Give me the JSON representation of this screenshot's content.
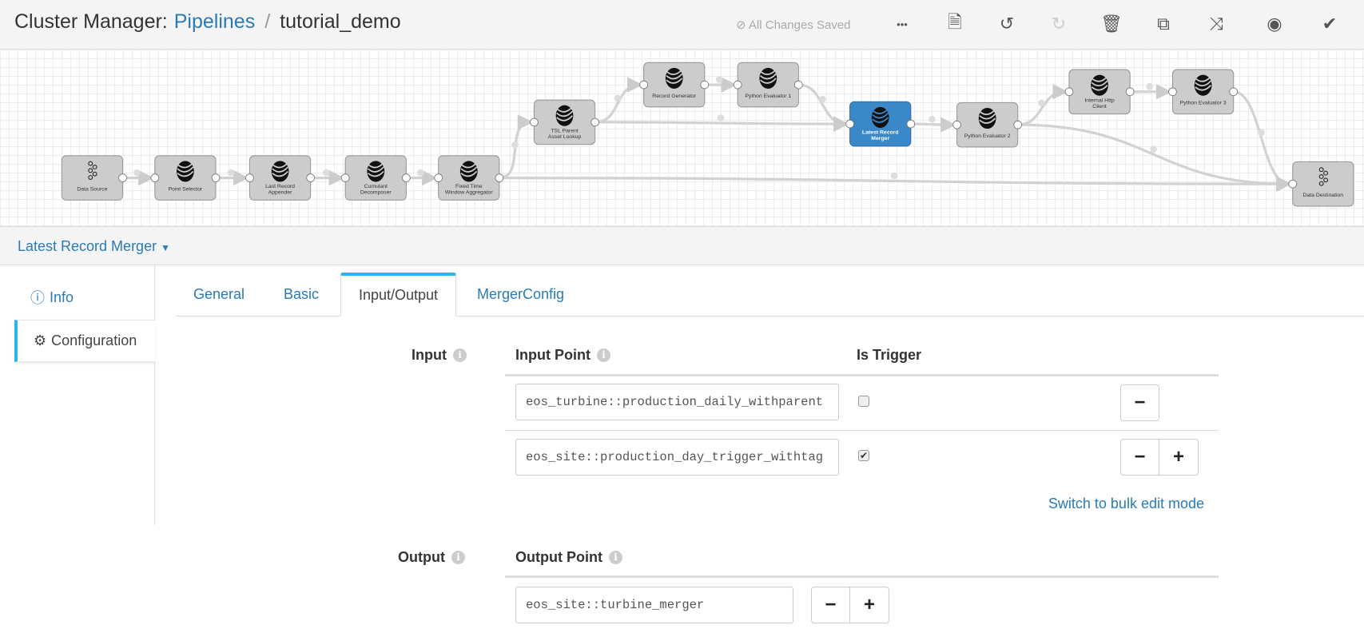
{
  "header": {
    "app": "Cluster Manager:",
    "breadcrumb_link": "Pipelines",
    "separator": "/",
    "pipeline": "tutorial_demo",
    "status": "All Changes Saved"
  },
  "toolbar": [
    {
      "icon": "ellipsis-icon",
      "glyph": "•••"
    },
    {
      "icon": "document-icon",
      "glyph": "🗎"
    },
    {
      "icon": "undo-icon",
      "glyph": "↺"
    },
    {
      "icon": "redo-icon",
      "glyph": "↻",
      "disabled": true
    },
    {
      "icon": "trash-icon",
      "glyph": "🗑"
    },
    {
      "icon": "copy-icon",
      "glyph": "⧉"
    },
    {
      "icon": "shuffle-icon",
      "glyph": "⤨"
    },
    {
      "icon": "eye-icon",
      "glyph": "◉"
    },
    {
      "icon": "check-circle-icon",
      "glyph": "✔"
    }
  ],
  "pipeline": {
    "nodes": [
      {
        "label": "Data Source",
        "type": "kafka"
      },
      {
        "label": "Point Selector",
        "type": "processor"
      },
      {
        "label": "Last Record Appender",
        "type": "processor"
      },
      {
        "label": "Cumulant Decomposer",
        "type": "processor"
      },
      {
        "label": "Fixed Time Window Aggregator",
        "type": "processor"
      },
      {
        "label": "TSL Parent Asset Lookup",
        "type": "processor"
      },
      {
        "label": "Record Generator",
        "type": "processor"
      },
      {
        "label": "Python Evaluator 1",
        "type": "processor"
      },
      {
        "label": "Latest Record Merger",
        "type": "processor",
        "selected": true
      },
      {
        "label": "Python Evaluator 2",
        "type": "processor"
      },
      {
        "label": "Internal Http Client",
        "type": "processor"
      },
      {
        "label": "Python Evaluator 3",
        "type": "processor"
      },
      {
        "label": "Data Destination",
        "type": "kafka"
      }
    ],
    "selected_color": "#3b88c9",
    "node_color": "#cccccc"
  },
  "selected_stage": "Latest Record Merger",
  "side_tabs": {
    "info": "Info",
    "configuration": "Configuration"
  },
  "tabs": [
    "General",
    "Basic",
    "Input/Output",
    "MergerConfig"
  ],
  "active_tab": "Input/Output",
  "input": {
    "label": "Input",
    "col_point": "Input Point",
    "col_trigger": "Is Trigger",
    "rows": [
      {
        "point": "eos_turbine::production_daily_withparent",
        "trigger": false
      },
      {
        "point": "eos_site::production_day_trigger_withtag",
        "trigger": true
      }
    ],
    "bulk_link": "Switch to bulk edit mode"
  },
  "output": {
    "label": "Output",
    "col_point": "Output Point",
    "rows": [
      {
        "point": "eos_site::turbine_merger"
      }
    ]
  },
  "colors": {
    "accent": "#2a7ab8",
    "active_tab_border": "#2ab6e8"
  }
}
